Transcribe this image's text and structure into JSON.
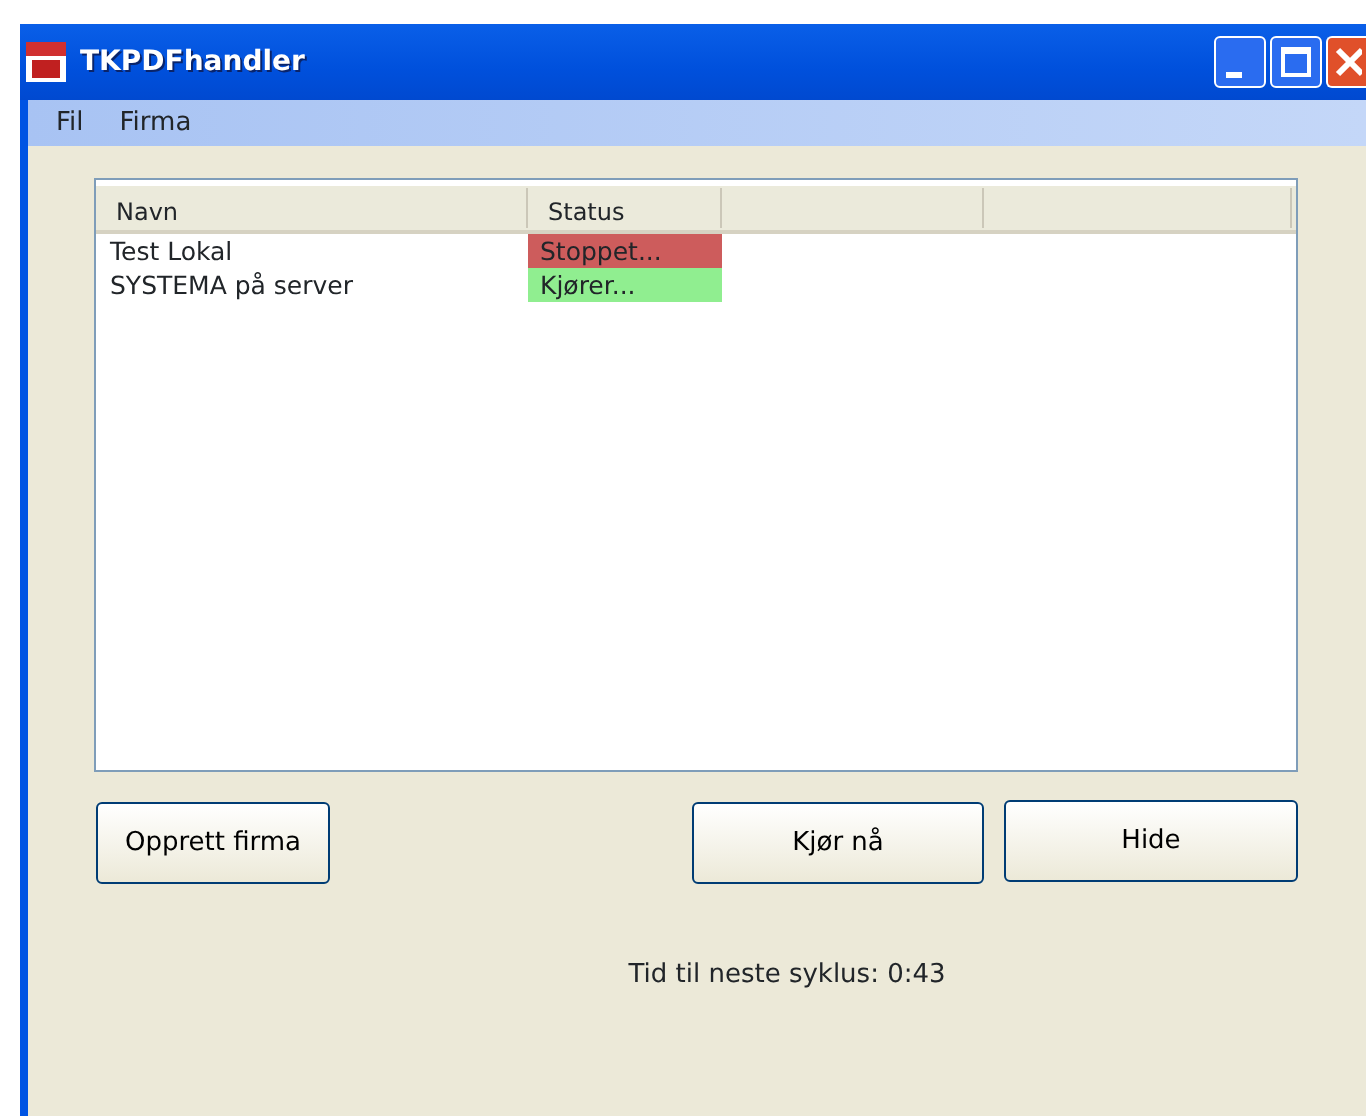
{
  "window": {
    "title": "TKPDFhandler"
  },
  "menu": [
    "Fil",
    "Firma"
  ],
  "table": {
    "columns": [
      "Navn",
      "Status"
    ],
    "rows": [
      {
        "name": "Test Lokal",
        "status": "Stoppet...",
        "color": "#cd5c5c"
      },
      {
        "name": "SYSTEMA på server",
        "status": "Kjører...",
        "color": "#90ee90"
      }
    ]
  },
  "buttons": [
    "Opprett firma",
    "Kjør nå",
    "Hide"
  ],
  "status_text": "Tid til neste syklus: 0:43"
}
